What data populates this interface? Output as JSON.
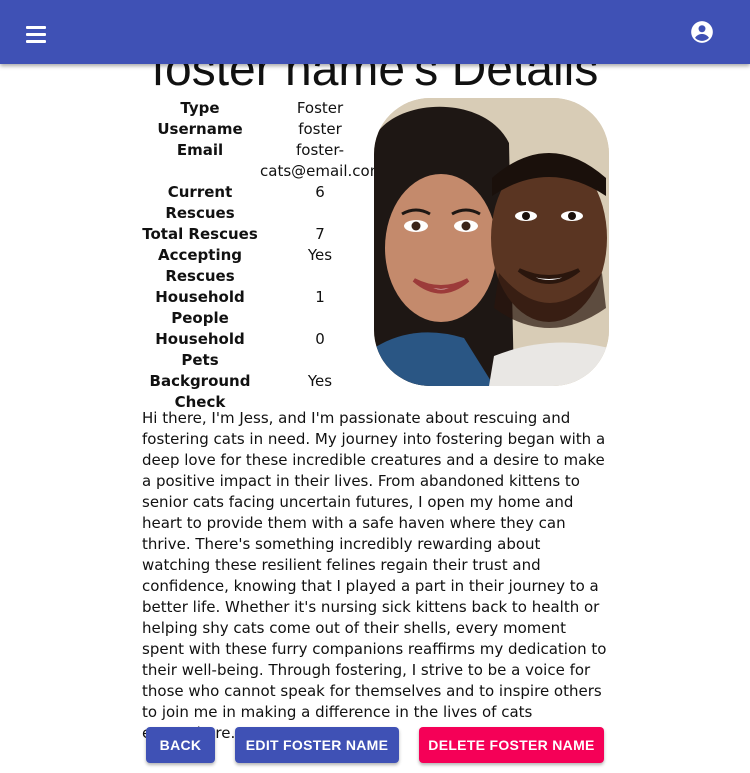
{
  "header": {
    "menu_icon": "menu-icon",
    "account_icon": "account-circle-icon",
    "bar_color": "#3f51b5"
  },
  "page": {
    "title": "foster name's Details"
  },
  "details": [
    {
      "label": "Type",
      "value": "Foster"
    },
    {
      "label": "Username",
      "value": "foster"
    },
    {
      "label": "Email",
      "value": "foster-cats@email.com"
    },
    {
      "label": "Current Rescues",
      "value": "6"
    },
    {
      "label": "Total Rescues",
      "value": "7"
    },
    {
      "label": "Accepting Rescues",
      "value": "Yes"
    },
    {
      "label": "Household People",
      "value": "1"
    },
    {
      "label": "Household Pets",
      "value": "0"
    },
    {
      "label": "Background Check",
      "value": "Yes"
    }
  ],
  "bio": "Hi there, I'm Jess, and I'm passionate about rescuing and fostering cats in need. My journey into fostering began with a deep love for these incredible creatures and a desire to make a positive impact in their lives. From abandoned kittens to senior cats facing uncertain futures, I open my home and heart to provide them with a safe haven where they can thrive. There's something incredibly rewarding about watching these resilient felines regain their trust and confidence, knowing that I played a part in their journey to a better life. Whether it's nursing sick kittens back to health or helping shy cats come out of their shells, every moment spent with these furry companions reaffirms my dedication to their well-being. Through fostering, I strive to be a voice for those who cannot speak for themselves and to inspire others to join me in making a difference in the lives of cats everywhere.",
  "actions": {
    "back_label": "BACK",
    "edit_label": "EDIT FOSTER NAME",
    "delete_label": "DELETE FOSTER NAME",
    "primary_color": "#3f51b5",
    "danger_color": "#f50057"
  }
}
